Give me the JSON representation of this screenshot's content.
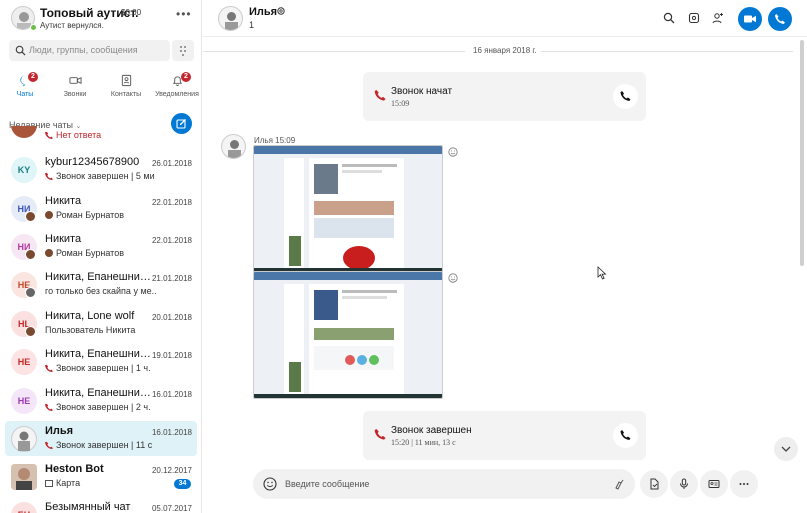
{
  "profile": {
    "name": "Топовый аутист.",
    "balance": "$0.00",
    "status_message": "Аутист вернулся.",
    "more": "•••"
  },
  "search": {
    "placeholder": "Люди, группы, сообщения"
  },
  "tabs": [
    {
      "label": "Чаты",
      "badge": "2",
      "active": true
    },
    {
      "label": "Звонки"
    },
    {
      "label": "Контакты"
    },
    {
      "label": "Уведомления",
      "badge": "2"
    }
  ],
  "recent_header": "Недавние чаты",
  "chats": [
    {
      "initials": "",
      "name": "",
      "date": "",
      "sub": "Нет ответа",
      "sub_red": true
    },
    {
      "initials": "KY",
      "name": "kybur12345678900",
      "date": "26.01.2018",
      "sub": "Звонок завершен | 5 ми",
      "phone": true
    },
    {
      "initials": "НИ",
      "name": "Никита",
      "date": "22.01.2018",
      "sub": "Роман Бурнатов",
      "mini": true
    },
    {
      "initials": "НИ",
      "name": "Никита",
      "date": "22.01.2018",
      "sub": "Роман Бурнатов",
      "mini": true
    },
    {
      "initials": "НЕ",
      "name": "Никита, Епанешнико...",
      "date": "21.01.2018",
      "sub": "го только без скайпа у ме...",
      "mini": true
    },
    {
      "initials": "НL",
      "name": "Никита, Lone wolf",
      "date": "20.01.2018",
      "sub": "Пользователь  Никита",
      "mini": true
    },
    {
      "initials": "НЕ",
      "name": "Никита, Епанешнико...",
      "date": "19.01.2018",
      "sub": "Звонок завершен | 1 ч. ",
      "phone": true
    },
    {
      "initials": "НЕ",
      "name": "Никита, Епанешнико...",
      "date": "16.01.2018",
      "sub": "Звонок завершен | 2 ч.",
      "phone": true
    },
    {
      "initials": "",
      "name": "Илья",
      "date": "16.01.2018",
      "sub": "Звонок завершен | 11 с",
      "phone": true,
      "selected": true
    },
    {
      "initials": "",
      "name": "Heston Bot",
      "date": "20.12.2017",
      "sub": "Карта",
      "unread": "34"
    },
    {
      "initials": "БЧ",
      "name": "Безымянный чат",
      "date": "05.07.2017",
      "sub": ""
    }
  ],
  "header": {
    "name": "Илья",
    "count": "1"
  },
  "date_separator": "16 января 2018 г.",
  "call_start": {
    "title": "Звонок начат",
    "time": "15:09"
  },
  "message_meta": "Илья  15:09",
  "call_end": {
    "title": "Звонок завершен",
    "detail": "15:20 | 11 мин, 13 с"
  },
  "composer": {
    "placeholder": "Введите сообщение"
  },
  "colors": {
    "accent": "#0078d4",
    "missed": "#c4262e",
    "selected_row": "#dff2f8"
  }
}
